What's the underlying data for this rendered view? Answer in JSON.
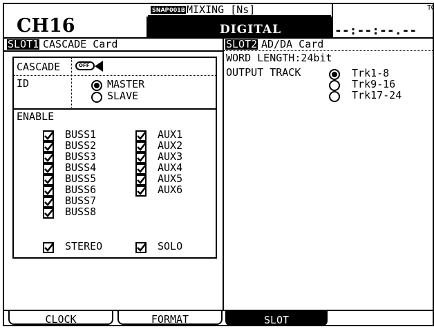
{
  "header": {
    "channel": "CH16",
    "snap_badge": "SNAP",
    "scene_code": "001B",
    "scene_name": "MIXING [Ns]",
    "mode": "DIGITAL",
    "timecode_label": "TC",
    "timecode": "--:--:--.--"
  },
  "slot1": {
    "title_tag": "SLOT1",
    "title": "CASCADE Card",
    "cascade_label": "CASCADE",
    "cascade_state": "OFF",
    "id_label": "ID",
    "id_options": [
      {
        "label": "MASTER",
        "selected": true
      },
      {
        "label": "SLAVE",
        "selected": false
      }
    ],
    "enable_label": "ENABLE",
    "buss_items": [
      {
        "label": "BUSS1",
        "checked": true
      },
      {
        "label": "BUSS2",
        "checked": true
      },
      {
        "label": "BUSS3",
        "checked": true
      },
      {
        "label": "BUSS4",
        "checked": true
      },
      {
        "label": "BUSS5",
        "checked": true
      },
      {
        "label": "BUSS6",
        "checked": true
      },
      {
        "label": "BUSS7",
        "checked": true
      },
      {
        "label": "BUSS8",
        "checked": true
      }
    ],
    "aux_items": [
      {
        "label": "AUX1",
        "checked": true
      },
      {
        "label": "AUX2",
        "checked": true
      },
      {
        "label": "AUX3",
        "checked": true
      },
      {
        "label": "AUX4",
        "checked": true
      },
      {
        "label": "AUX5",
        "checked": true
      },
      {
        "label": "AUX6",
        "checked": true
      }
    ],
    "stereo_label": "STEREO",
    "solo_label": "SOLO"
  },
  "slot2": {
    "title_tag": "SLOT2",
    "title": "AD/DA Card",
    "word_length_label": "WORD LENGTH:",
    "word_length_value": "24bit",
    "output_track_label": "OUTPUT TRACK",
    "output_options": [
      {
        "label": "Trk1-8",
        "selected": true
      },
      {
        "label": "Trk9-16",
        "selected": false
      },
      {
        "label": "Trk17-24",
        "selected": false
      }
    ]
  },
  "tabs": [
    {
      "label": "CLOCK",
      "active": false
    },
    {
      "label": "FORMAT",
      "active": false
    },
    {
      "label": "SLOT",
      "active": true
    }
  ]
}
